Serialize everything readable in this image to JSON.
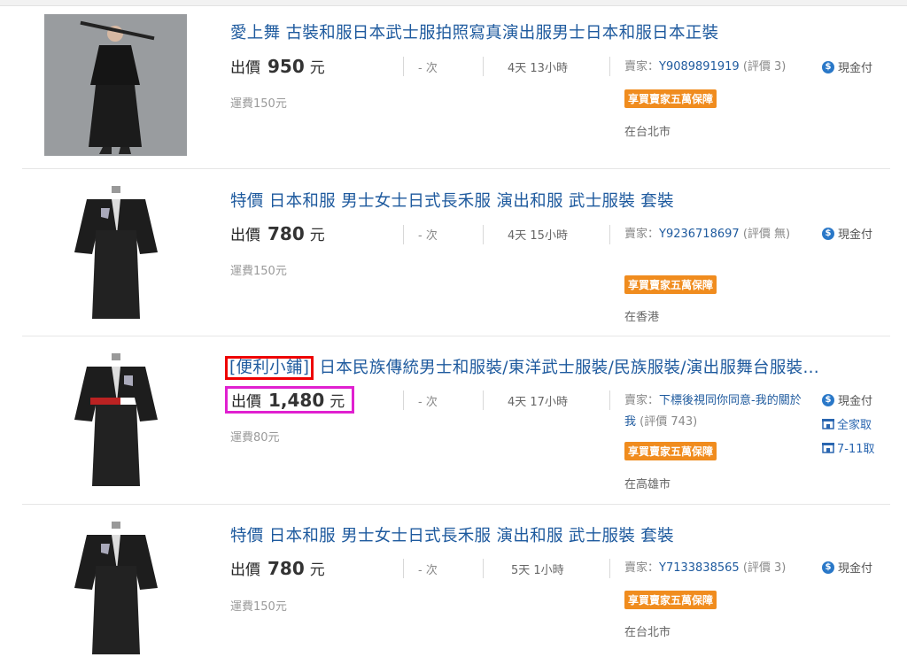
{
  "listings": [
    {
      "title": "愛上舞 古裝和服日本武士服拍照寫真演出服男士日本和服日本正裝",
      "price_label": "出價",
      "price": "950",
      "unit": "元",
      "shipping": "運費150元",
      "bids": "- 次",
      "time_left": "4天 13小時",
      "seller_label": "賣家：",
      "seller_id": "Y9089891919",
      "rating": "(評價 3)",
      "badge": "享買賣家五萬保障",
      "location": "在台北市",
      "payments": [
        "現金付"
      ]
    },
    {
      "title": "特價 日本和服 男士女士日式長禾服 演出和服 武士服裝 套裝",
      "price_label": "出價",
      "price": "780",
      "unit": "元",
      "shipping": "運費150元",
      "bids": "- 次",
      "time_left": "4天 15小時",
      "seller_label": "賣家：",
      "seller_id": "Y9236718697",
      "rating": "(評價 無)",
      "badge": "享買賣家五萬保障",
      "location": "在香港",
      "payments": [
        "現金付"
      ]
    },
    {
      "title_tag": "[便利小鋪]",
      "title": "日本民族傳統男士和服裝/東洋武士服裝/民族服裝/演出服舞台服裝...",
      "price_label": "出價",
      "price": "1,480",
      "unit": "元",
      "shipping": "運費80元",
      "bids": "- 次",
      "time_left": "4天 17小時",
      "seller_label": "賣家：",
      "seller_id": "下標後視同你同意-我的關於我",
      "rating": "(評價 743)",
      "badge": "享買賣家五萬保障",
      "location": "在高雄市",
      "payments": [
        "現金付",
        "全家取",
        "7-11取"
      ]
    },
    {
      "title": "特價 日本和服 男士女士日式長禾服 演出和服 武士服裝 套裝",
      "price_label": "出價",
      "price": "780",
      "unit": "元",
      "shipping": "運費150元",
      "bids": "- 次",
      "time_left": "5天 1小時",
      "seller_label": "賣家：",
      "seller_id": "Y7133838565",
      "rating": "(評價 3)",
      "badge": "享買賣家五萬保障",
      "location": "在台北市",
      "payments": [
        "現金付"
      ]
    }
  ],
  "icons": {
    "cash": "dollar-coin-icon",
    "store": "convenience-store-icon"
  },
  "colors": {
    "title_link": "#1e5a9e",
    "badge": "#f08c1e",
    "tag_highlight": "#e00000",
    "price_highlight": "#e020d0"
  }
}
